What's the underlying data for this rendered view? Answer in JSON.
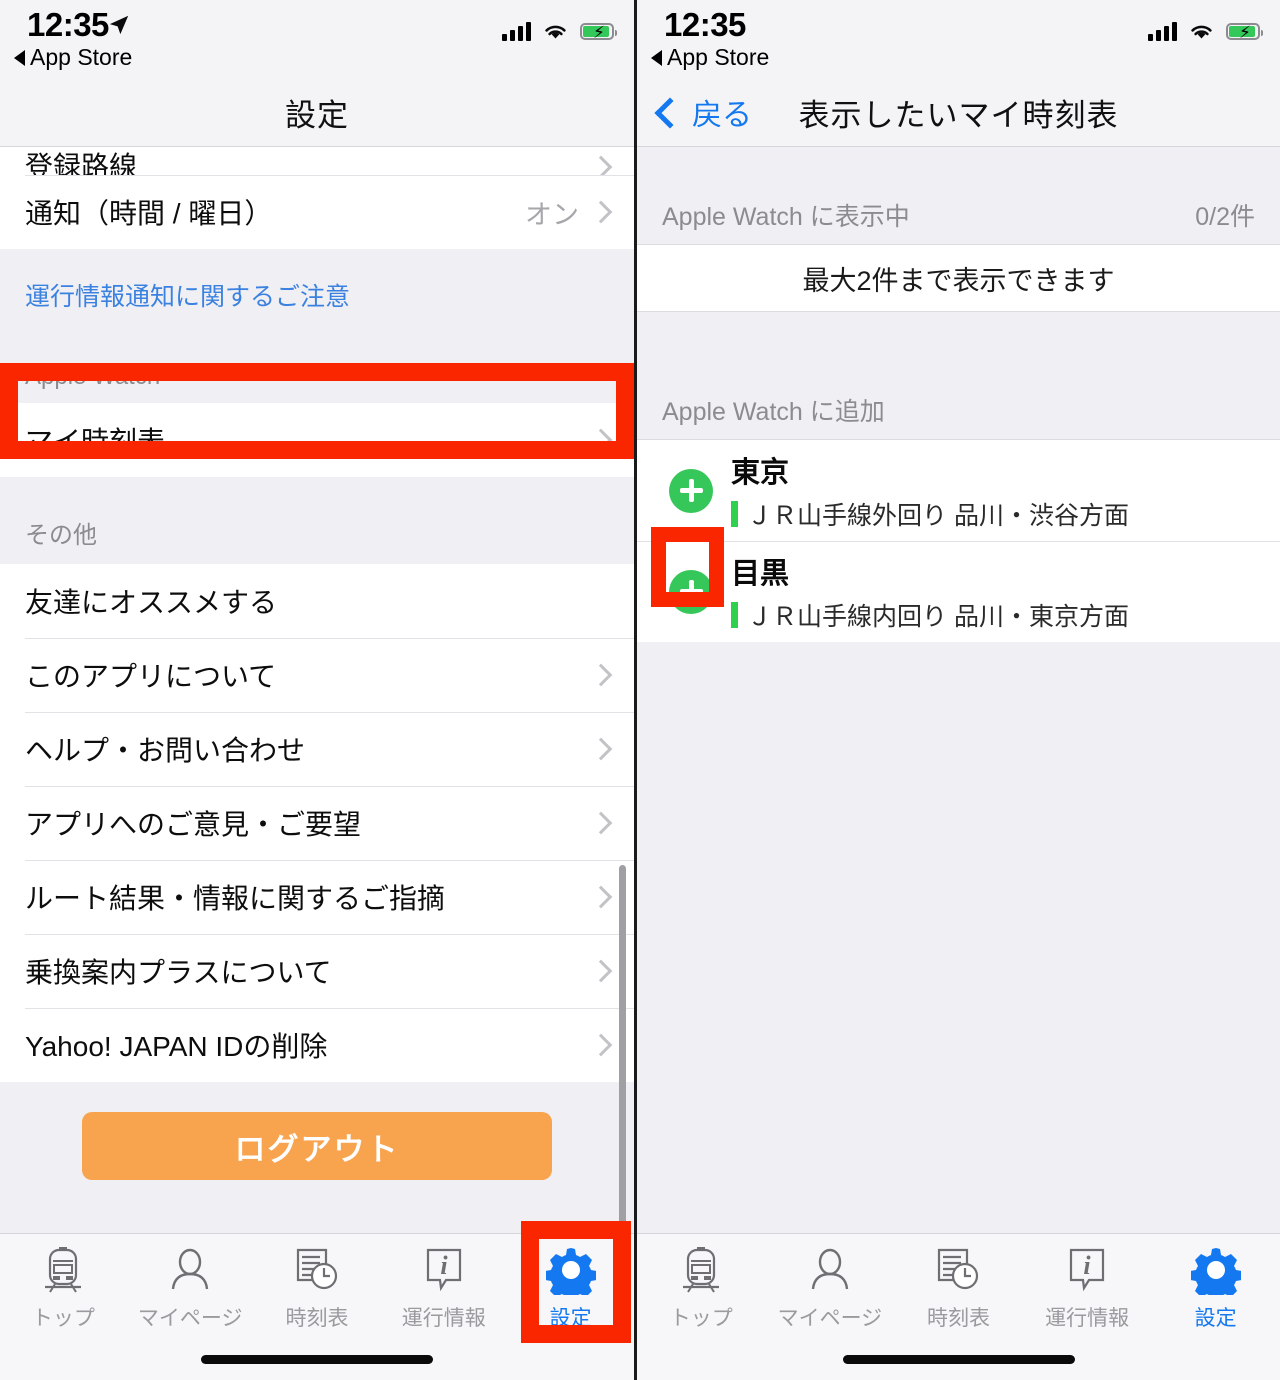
{
  "status_bar": {
    "time": "12:35",
    "back_app_label": "App Store",
    "location_icon": "location-arrow-icon",
    "signal_icon": "cellular-bars-icon",
    "wifi_icon": "wifi-icon",
    "battery_icon": "battery-charging-icon"
  },
  "left_screen": {
    "nav_title": "設定",
    "rows_top": [
      {
        "label": "登録路線",
        "value": "",
        "chevron": true
      },
      {
        "label": "通知（時間 / 曜日）",
        "value": "オン",
        "chevron": true
      }
    ],
    "note_link": "運行情報通知に関するご注意",
    "section_apple_watch": "Apple Watch",
    "apple_watch_rows": [
      {
        "label": "マイ時刻表",
        "value": "",
        "chevron": true
      }
    ],
    "section_other": "その他",
    "other_rows": [
      {
        "label": "友達にオススメする",
        "value": "",
        "chevron": false
      },
      {
        "label": "このアプリについて",
        "value": "",
        "chevron": true
      },
      {
        "label": "ヘルプ・お問い合わせ",
        "value": "",
        "chevron": true
      },
      {
        "label": "アプリへのご意見・ご要望",
        "value": "",
        "chevron": true
      },
      {
        "label": "ルート結果・情報に関するご指摘",
        "value": "",
        "chevron": true
      },
      {
        "label": "乗換案内プラスについて",
        "value": "",
        "chevron": true
      },
      {
        "label": "Yahoo! JAPAN IDの削除",
        "value": "",
        "chevron": true
      }
    ],
    "logout_label": "ログアウト"
  },
  "right_screen": {
    "nav_back_label": "戻る",
    "nav_title": "表示したいマイ時刻表",
    "displaying_label": "Apple Watch に表示中",
    "displaying_count": "0/2件",
    "max_notice": "最大2件まで表示できます",
    "add_section_label": "Apple Watch に追加",
    "stations": [
      {
        "name": "東京",
        "line": "ＪＲ山手線外回り 品川・渋谷方面",
        "add_button": "add-button"
      },
      {
        "name": "目黒",
        "line": "ＪＲ山手線内回り 品川・東京方面",
        "add_button": "add-button"
      }
    ]
  },
  "tab_bar": {
    "tabs": [
      {
        "label": "トップ",
        "icon": "train-icon",
        "active": false
      },
      {
        "label": "マイページ",
        "icon": "person-icon",
        "active": false
      },
      {
        "label": "時刻表",
        "icon": "timetable-clock-icon",
        "active": false
      },
      {
        "label": "運行情報",
        "icon": "info-bubble-icon",
        "active": false
      },
      {
        "label": "設定",
        "icon": "gear-icon",
        "active": true
      }
    ]
  },
  "colors": {
    "annotation_red": "#fa2600",
    "accent_blue": "#1478f0",
    "logout_orange": "#f8a34e",
    "add_green": "#35c759",
    "line_green": "#2fd04e",
    "group_bg": "#f0f0f4"
  }
}
